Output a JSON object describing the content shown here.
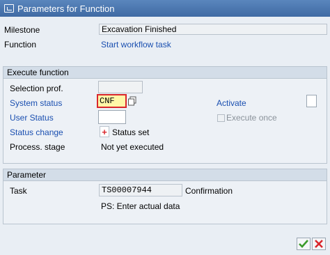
{
  "window": {
    "title": "Parameters for Function"
  },
  "header": {
    "milestone_label": "Milestone",
    "milestone_value": "Excavation Finished",
    "function_label": "Function",
    "function_value": "Start workflow task"
  },
  "execute_group": {
    "title": "Execute function",
    "selection_prof_label": "Selection prof.",
    "selection_prof_value": "",
    "system_status_label": "System status",
    "system_status_value": "CNF",
    "user_status_label": "User Status",
    "user_status_value": "",
    "status_change_label": "Status change",
    "status_set_label": "Status set",
    "process_stage_label": "Process. stage",
    "process_stage_value": "Not yet executed",
    "activate_label": "Activate",
    "execute_once_label": "Execute once"
  },
  "parameter_group": {
    "title": "Parameter",
    "task_label": "Task",
    "task_value": "TS00007944",
    "task_desc": "Confirmation",
    "task_note": "PS: Enter actual data"
  },
  "footer": {
    "ok_icon": "check-icon",
    "cancel_icon": "cancel-icon"
  },
  "colors": {
    "title_bar": "#4a76b0",
    "link_text": "#1a4fb0",
    "highlight_border": "#d9262c",
    "highlight_fill": "#fff7a8"
  }
}
